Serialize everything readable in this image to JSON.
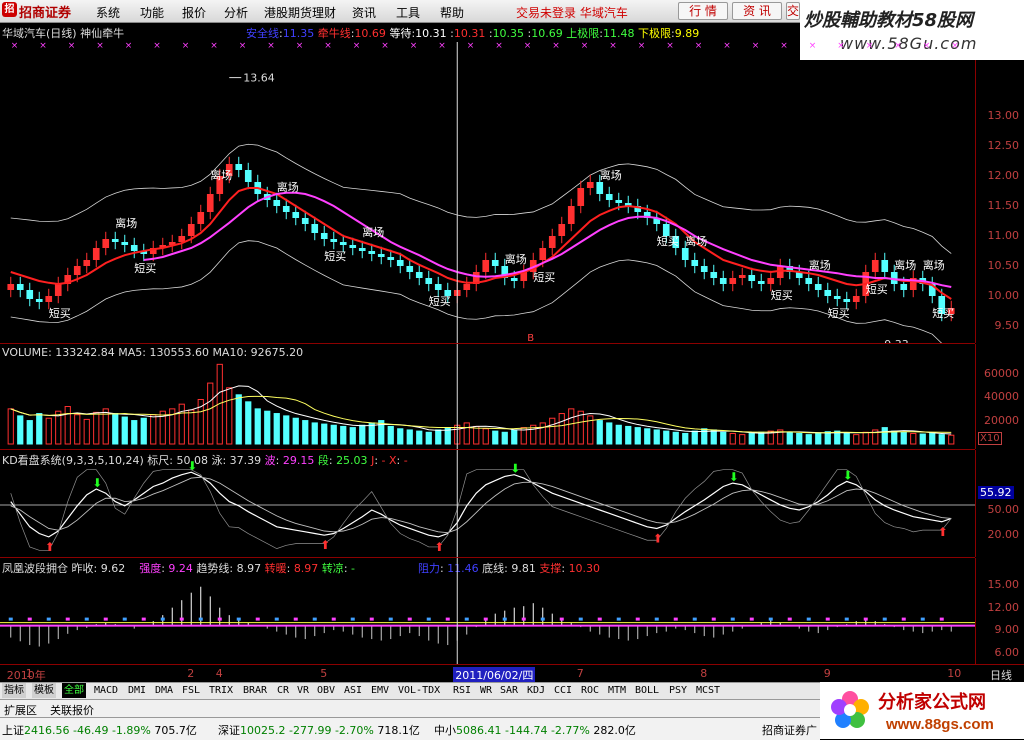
{
  "app": {
    "logo": "招商证券",
    "logo_mark": "招"
  },
  "menu": [
    "系统",
    "功能",
    "报价",
    "分析",
    "港股期货理财",
    "资讯",
    "工具",
    "帮助"
  ],
  "status_msg": "交易未登录 华域汽车",
  "buttons": {
    "quote": "行 情",
    "info": "资 讯",
    "trade": "交 易"
  },
  "watermark": {
    "line1": "炒股輔助教材58股网",
    "line2": "www.58Gu.com"
  },
  "chart_data": [
    {
      "type": "candlestick",
      "title": "华域汽车(日线) 神仙牵牛",
      "indicators": [
        {
          "name": "安全线",
          "value": "11.35",
          "color": "#0000ff"
        },
        {
          "name": "牵牛线",
          "value": "10.69",
          "color": "#ff3030"
        },
        {
          "name": "等待",
          "value": "10.31",
          "color": "#ffffff"
        },
        {
          "name": "",
          "value": "10.31",
          "color": "#ff3030"
        },
        {
          "name": "",
          "value": "10.35",
          "color": "#40ff40"
        },
        {
          "name": "",
          "value": "10.69",
          "color": "#40ff40"
        },
        {
          "name": "上极限",
          "value": "11.48",
          "color": "#40ff40"
        },
        {
          "name": "下极限",
          "value": "9.89",
          "color": "#ffff00"
        }
      ],
      "y_ticks": [
        "13.00",
        "12.50",
        "12.00",
        "11.50",
        "11.00",
        "10.50",
        "10.00",
        "9.50"
      ],
      "ylim": [
        9.3,
        13.9
      ],
      "high_label": "13.64",
      "low_label": "9.33",
      "annotations": {
        "buy": "短买",
        "exit": "离场"
      },
      "cursor_label": "B",
      "close": [
        10.2,
        10.1,
        9.95,
        9.9,
        10.0,
        10.2,
        10.35,
        10.5,
        10.6,
        10.8,
        10.95,
        10.9,
        10.85,
        10.75,
        10.7,
        10.8,
        10.85,
        10.9,
        11.0,
        11.2,
        11.4,
        11.7,
        12.0,
        12.2,
        12.1,
        11.9,
        11.7,
        11.6,
        11.5,
        11.4,
        11.3,
        11.2,
        11.05,
        10.95,
        10.9,
        10.85,
        10.8,
        10.75,
        10.7,
        10.65,
        10.6,
        10.5,
        10.4,
        10.3,
        10.2,
        10.1,
        10.0,
        10.1,
        10.2,
        10.4,
        10.6,
        10.5,
        10.3,
        10.25,
        10.4,
        10.6,
        10.8,
        11.0,
        11.2,
        11.5,
        11.8,
        11.9,
        11.7,
        11.6,
        11.55,
        11.5,
        11.4,
        11.3,
        11.2,
        11.0,
        10.8,
        10.6,
        10.5,
        10.4,
        10.3,
        10.2,
        10.3,
        10.35,
        10.25,
        10.2,
        10.3,
        10.5,
        10.4,
        10.3,
        10.2,
        10.1,
        10.0,
        9.95,
        9.9,
        10.0,
        10.4,
        10.6,
        10.4,
        10.2,
        10.1,
        10.3,
        10.2,
        10.0,
        9.7,
        9.8
      ],
      "ma_red": [
        10.4,
        10.35,
        10.3,
        10.25,
        10.22,
        10.2,
        10.22,
        10.28,
        10.35,
        10.45,
        10.55,
        10.62,
        10.68,
        10.72,
        10.75,
        10.78,
        10.8,
        10.84,
        10.88,
        10.95,
        11.05,
        11.2,
        11.4,
        11.6,
        11.75,
        11.8,
        11.8,
        11.75,
        11.7,
        11.6,
        11.5,
        11.4,
        11.3,
        11.2,
        11.1,
        11.0,
        10.95,
        10.9,
        10.85,
        10.8,
        10.75,
        10.7,
        10.6,
        10.52,
        10.45,
        10.38,
        10.3,
        10.25,
        10.22,
        10.22,
        10.25,
        10.3,
        10.32,
        10.35,
        10.4,
        10.45,
        10.55,
        10.65,
        10.8,
        10.95,
        11.1,
        11.25,
        11.35,
        11.42,
        11.48,
        11.5,
        11.48,
        11.45,
        11.4,
        11.3,
        11.2,
        11.05,
        10.9,
        10.8,
        10.7,
        10.6,
        10.55,
        10.5,
        10.45,
        10.42,
        10.4,
        10.42,
        10.42,
        10.4,
        10.38,
        10.35,
        10.3,
        10.25,
        10.2,
        10.18,
        10.2,
        10.25,
        10.3,
        10.28,
        10.25,
        10.25,
        10.22,
        10.18,
        10.05,
        9.95
      ],
      "ma_pink": [
        null,
        null,
        null,
        null,
        null,
        null,
        null,
        null,
        null,
        null,
        null,
        null,
        null,
        null,
        10.6,
        10.62,
        10.65,
        10.7,
        10.75,
        10.8,
        10.88,
        10.98,
        11.1,
        11.22,
        11.35,
        11.48,
        11.58,
        11.65,
        11.7,
        11.72,
        11.72,
        11.7,
        11.65,
        11.58,
        11.5,
        11.4,
        11.3,
        11.2,
        11.1,
        11.0,
        10.9,
        10.82,
        10.75,
        10.68,
        10.6,
        10.52,
        10.45,
        10.4,
        10.36,
        10.33,
        10.32,
        10.33,
        10.35,
        10.38,
        10.42,
        10.48,
        10.55,
        10.62,
        10.7,
        10.8,
        10.9,
        11.0,
        11.1,
        11.18,
        11.25,
        11.3,
        11.32,
        11.32,
        11.3,
        11.25,
        11.18,
        11.1,
        11.0,
        10.92,
        10.85,
        10.78,
        10.72,
        10.66,
        10.6,
        10.56,
        10.52,
        10.5,
        10.48,
        10.46,
        10.44,
        10.42,
        10.4,
        10.38,
        10.35,
        10.33,
        10.32,
        10.3,
        10.3,
        10.28,
        10.27,
        10.26,
        10.25,
        10.22,
        10.18,
        10.15
      ]
    },
    {
      "type": "bar",
      "title": "VOLUME: 133242.84 MA5: 130553.60 MA10: 92675.20",
      "y_ticks": [
        "60000",
        "40000",
        "20000"
      ],
      "ylim": [
        0,
        70000
      ],
      "unit_badge": "X10",
      "values": [
        30000,
        24000,
        20000,
        26000,
        22000,
        28000,
        32000,
        25000,
        21000,
        27000,
        30000,
        26000,
        23000,
        20000,
        22000,
        25000,
        28000,
        30000,
        34000,
        29000,
        38000,
        52000,
        68000,
        48000,
        42000,
        36000,
        30000,
        28000,
        26000,
        24000,
        22000,
        20000,
        18000,
        17000,
        16000,
        15000,
        14000,
        16000,
        18000,
        20000,
        15000,
        13000,
        12000,
        11000,
        10000,
        12000,
        14000,
        16000,
        18000,
        15000,
        13000,
        11000,
        10000,
        12000,
        14000,
        16000,
        18000,
        22000,
        26000,
        30000,
        28000,
        24000,
        20000,
        18000,
        16000,
        15000,
        14000,
        13000,
        12000,
        11000,
        10000,
        9000,
        11000,
        13000,
        12000,
        10000,
        9000,
        8000,
        9000,
        10000,
        11000,
        12000,
        10000,
        9000,
        8000,
        9500,
        10500,
        11000,
        9000,
        8000,
        10000,
        12000,
        14000,
        11000,
        10000,
        9000,
        8500,
        9500,
        8000,
        7500
      ]
    },
    {
      "type": "line",
      "title": "KD看盘系统(9,3,3,5,10,24)",
      "params": [
        {
          "name": "标尺",
          "value": "50.08",
          "color": "#dddddd"
        },
        {
          "name": "泳",
          "value": "37.39",
          "color": "#dddddd"
        },
        {
          "name": "波",
          "value": "29.15",
          "color": "#ff40ff"
        },
        {
          "name": "段",
          "value": "25.03",
          "color": "#40ff40"
        },
        {
          "name": "J",
          "value": "-",
          "color": "#ff3030"
        },
        {
          "name": "X",
          "value": "-",
          "color": "#ff3030"
        }
      ],
      "y_ticks": [
        "50.00",
        "20.00"
      ],
      "current_badge": "55.92",
      "ylim": [
        0,
        100
      ],
      "k": [
        60,
        45,
        30,
        22,
        18,
        25,
        40,
        55,
        68,
        75,
        70,
        60,
        55,
        62,
        70,
        78,
        82,
        88,
        92,
        95,
        90,
        82,
        70,
        60,
        55,
        48,
        42,
        36,
        30,
        28,
        26,
        24,
        22,
        20,
        22,
        28,
        35,
        42,
        50,
        45,
        38,
        32,
        28,
        24,
        20,
        18,
        22,
        35,
        55,
        70,
        80,
        85,
        90,
        92,
        88,
        82,
        76,
        70,
        66,
        62,
        58,
        54,
        50,
        46,
        42,
        38,
        34,
        30,
        28,
        32,
        40,
        48,
        55,
        62,
        70,
        78,
        82,
        80,
        74,
        68,
        62,
        56,
        52,
        50,
        54,
        60,
        68,
        78,
        84,
        80,
        72,
        62,
        55,
        50,
        46,
        42,
        40,
        38,
        36,
        40
      ],
      "d": [
        55,
        50,
        42,
        35,
        28,
        26,
        30,
        38,
        48,
        58,
        64,
        64,
        60,
        61,
        64,
        69,
        73,
        78,
        83,
        88,
        89,
        87,
        82,
        75,
        68,
        61,
        55,
        49,
        43,
        38,
        34,
        31,
        28,
        25,
        24,
        25,
        28,
        33,
        39,
        41,
        40,
        37,
        34,
        30,
        27,
        24,
        23,
        27,
        36,
        47,
        58,
        67,
        75,
        81,
        83,
        83,
        81,
        78,
        74,
        70,
        66,
        62,
        58,
        54,
        50,
        46,
        42,
        38,
        35,
        34,
        36,
        40,
        45,
        51,
        57,
        64,
        70,
        73,
        74,
        72,
        69,
        65,
        61,
        57,
        56,
        57,
        61,
        67,
        73,
        75,
        74,
        70,
        65,
        60,
        55,
        51,
        47,
        44,
        41,
        40
      ]
    },
    {
      "type": "bar",
      "title": "凤凰波段拥仓",
      "params": [
        {
          "name": "昨收",
          "value": "9.62",
          "color": "#dddddd"
        },
        {
          "name": "强度",
          "value": "9.24",
          "color": "#ff40ff"
        },
        {
          "name": "趋势线",
          "value": "8.97",
          "color": "#dddddd"
        },
        {
          "name": "转暖",
          "value": "8.97",
          "color": "#ff3030"
        },
        {
          "name": "转凉",
          "value": "-",
          "color": "#40ff40"
        },
        {
          "name": "阻力",
          "value": "11.46",
          "color": "#0000ff"
        },
        {
          "name": "底线",
          "value": "9.81",
          "color": "#dddddd"
        },
        {
          "name": "支撑",
          "value": "10.30",
          "color": "#ff3030"
        }
      ],
      "y_ticks": [
        "15.00",
        "12.00",
        "9.00",
        "6.00"
      ],
      "ylim": [
        5,
        16.5
      ],
      "baseline": 9.6,
      "values": [
        8.0,
        7.5,
        7.0,
        6.8,
        7.2,
        7.8,
        8.5,
        9.0,
        9.3,
        9.8,
        10.0,
        9.8,
        9.5,
        9.2,
        9.5,
        10.2,
        11.0,
        12.0,
        13.0,
        14.0,
        14.8,
        13.5,
        12.0,
        11.0,
        10.5,
        10.0,
        9.6,
        9.2,
        8.8,
        8.4,
        8.0,
        7.8,
        8.2,
        8.6,
        9.0,
        8.8,
        8.4,
        8.0,
        7.8,
        7.6,
        7.8,
        8.2,
        8.6,
        8.2,
        7.6,
        7.2,
        7.0,
        7.6,
        8.4,
        9.4,
        10.4,
        11.2,
        11.6,
        12.0,
        12.2,
        12.6,
        12.0,
        11.2,
        10.6,
        10.0,
        9.4,
        8.8,
        8.4,
        8.0,
        7.8,
        7.6,
        7.8,
        8.2,
        8.6,
        8.8,
        9.2,
        9.0,
        8.6,
        8.2,
        8.0,
        8.4,
        8.8,
        9.2,
        9.6,
        10.0,
        10.4,
        10.0,
        9.6,
        9.2,
        8.8,
        8.6,
        9.0,
        9.4,
        9.8,
        10.2,
        10.6,
        10.2,
        9.8,
        9.4,
        9.0,
        8.8,
        8.6,
        8.8,
        9.0,
        8.8
      ]
    }
  ],
  "date_axis": {
    "marks": [
      {
        "label": "2010年",
        "col": 0
      },
      {
        "label": "1",
        "col": 2
      },
      {
        "label": "2",
        "col": 19
      },
      {
        "label": "4",
        "col": 22
      },
      {
        "label": "5",
        "col": 33
      },
      {
        "label": "2011/06/02/四",
        "col": 47
      },
      {
        "label": "7",
        "col": 60
      },
      {
        "label": "8",
        "col": 73
      },
      {
        "label": "9",
        "col": 86
      },
      {
        "label": "10",
        "col": 99
      }
    ],
    "period": "日线"
  },
  "tabs": [
    "指标",
    "模板",
    "全部",
    "MACD",
    "DMI",
    "DMA",
    "FSL",
    "TRIX",
    "BRAR",
    "CR",
    "VR",
    "OBV",
    "ASI",
    "EMV",
    "VOL-TDX",
    "RSI",
    "WR",
    "SAR",
    "KDJ",
    "CCI",
    "ROC",
    "MTM",
    "BOLL",
    "PSY",
    "MCST"
  ],
  "extend_bar": {
    "ext": "扩展区",
    "linked": "关联报价"
  },
  "status_bar": [
    {
      "name": "上证",
      "index": "2416.56",
      "chg": "-46.49",
      "pct": "-1.89%",
      "amount": "705.7亿"
    },
    {
      "name": "深证",
      "index": "10025.2",
      "chg": "-277.99",
      "pct": "-2.70%",
      "amount": "718.1亿"
    },
    {
      "name": "中小",
      "index": "5086.41",
      "chg": "-144.74",
      "pct": "-2.77%",
      "amount": "282.0亿"
    }
  ],
  "broker_label": "招商证券广",
  "brand": {
    "name": "分析家公式网",
    "url": "www.88gs.com"
  },
  "colors": {
    "up": "#ff3030",
    "down": "#54ffff",
    "axis": "#8b0000",
    "tick_text": "#c04040"
  }
}
